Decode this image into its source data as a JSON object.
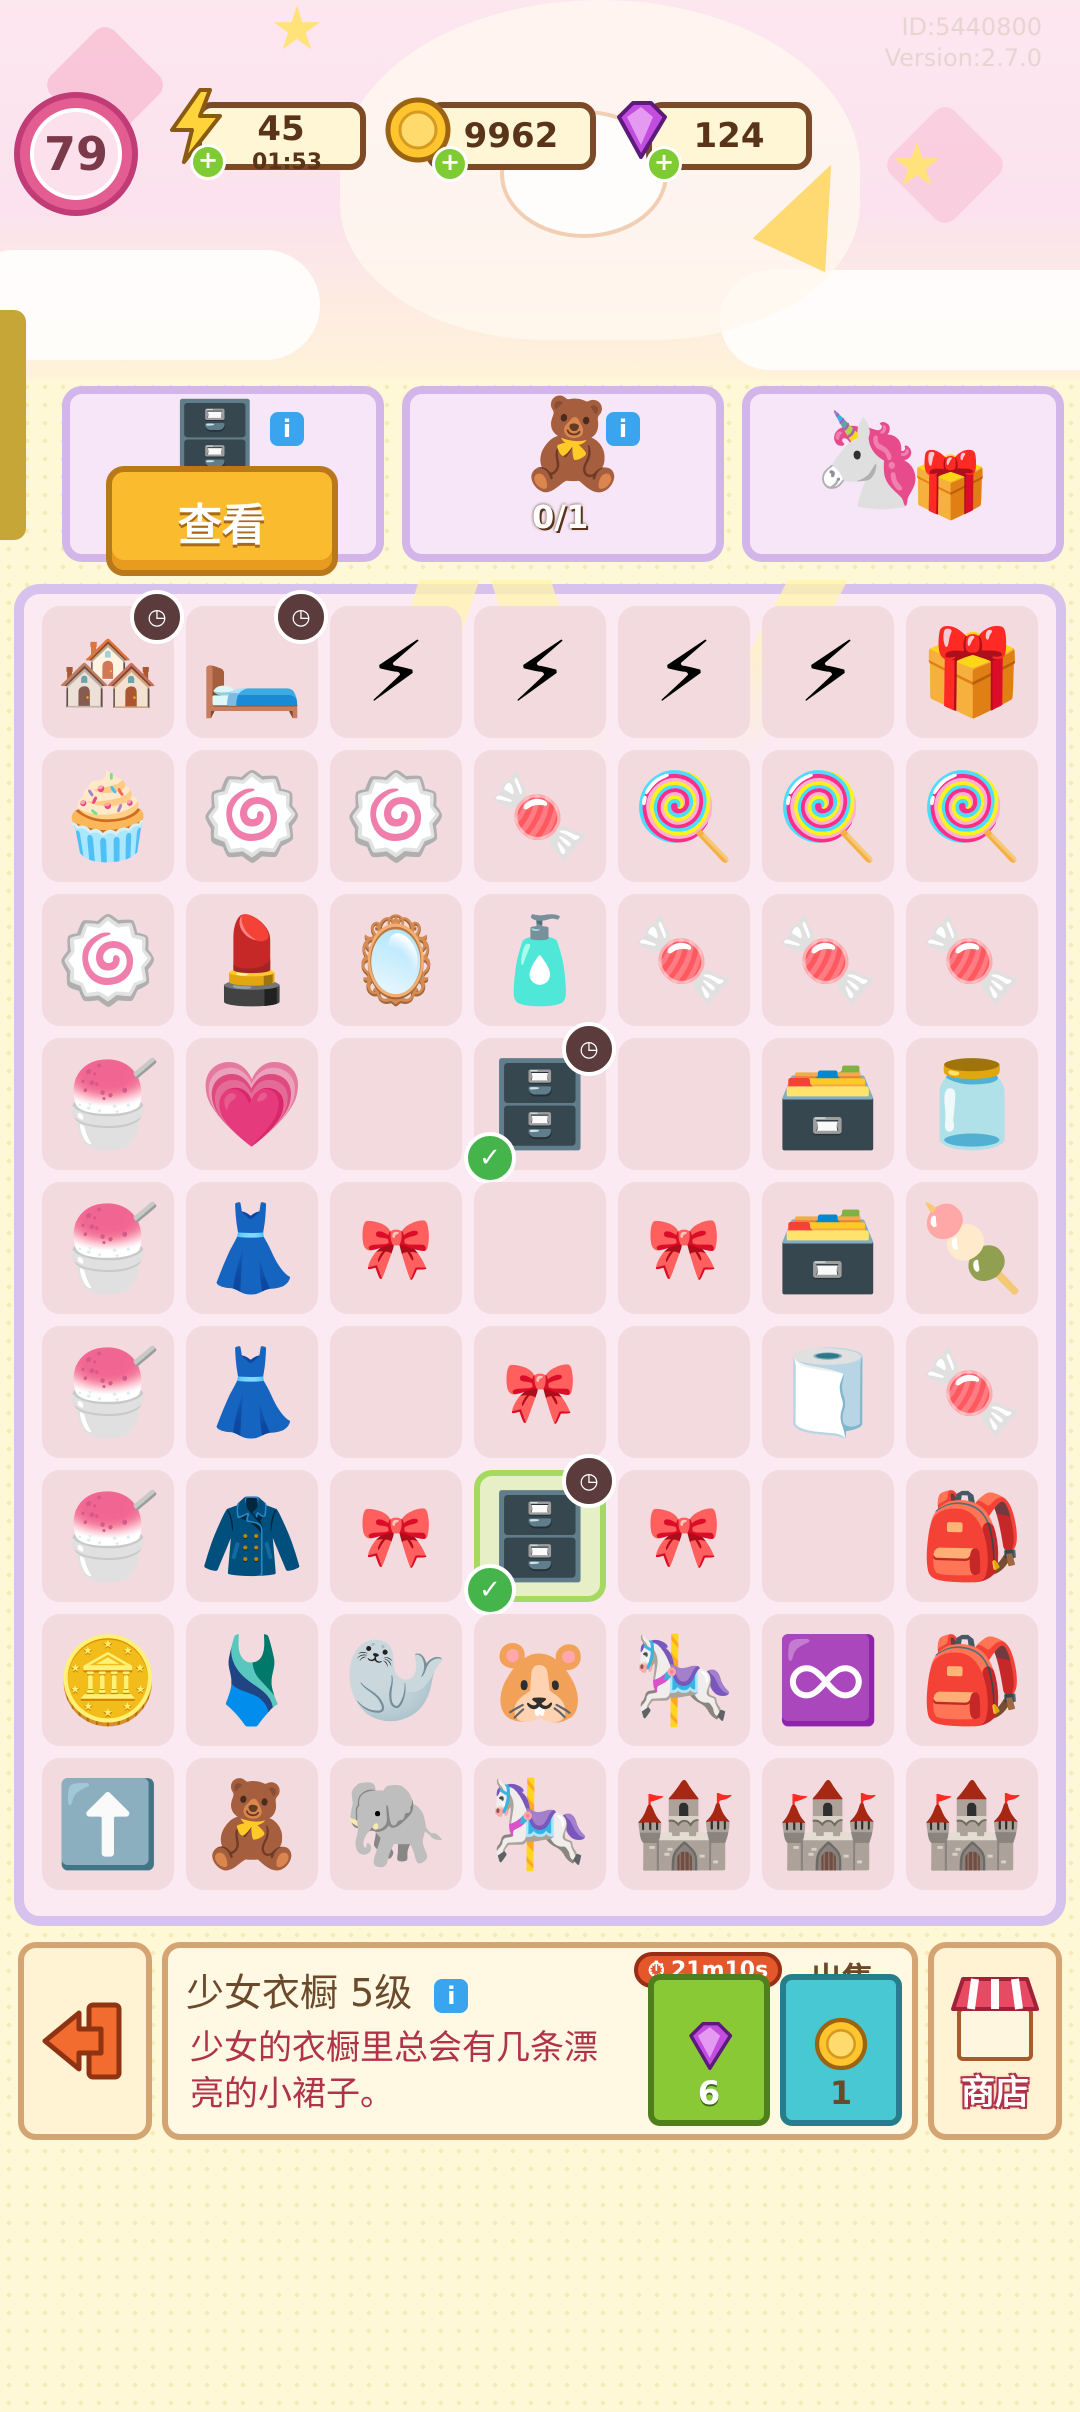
{
  "header": {
    "id_text": "ID:5440800",
    "version_text": "Version:2.7.0",
    "level": "79",
    "energy": {
      "value": "45",
      "timer": "01:53",
      "icon": "lightning-icon"
    },
    "coins": {
      "value": "9962",
      "icon": "coin-icon"
    },
    "gems": {
      "value": "124",
      "icon": "gem-icon"
    }
  },
  "tasks": {
    "view_button_label": "查看",
    "card2_progress": "0/1"
  },
  "board": {
    "cells": [
      [
        "🏘️",
        "🛏️",
        "⚡",
        "⚡",
        "⚡",
        "⚡",
        "🎁"
      ],
      [
        "🧁",
        "🍥",
        "🍥",
        "🍬",
        "🍭",
        "🍭",
        "🍭"
      ],
      [
        "🍥",
        "💄",
        "🪞",
        "🧴",
        "🍬",
        "🍬",
        "🍬"
      ],
      [
        "🍧",
        "💗",
        "",
        "🗄️",
        "",
        "🗃️",
        "🫙"
      ],
      [
        "🍧",
        "👗",
        "🎀",
        "",
        "🎀",
        "🗃️",
        "🍡"
      ],
      [
        "🍧",
        "👗",
        "",
        "🎀",
        "",
        "🧻",
        "🍬"
      ],
      [
        "🍧",
        "🧥",
        "🎀",
        "🗄️",
        "🎀",
        "",
        "🎒"
      ],
      [
        "🪙",
        "🩱",
        "🦭",
        "🐹",
        "🎠",
        "♾️",
        "🎒"
      ],
      [
        "⬆️",
        "🧸",
        "🐘",
        "🎠",
        "🏰",
        "🏰",
        "🏰"
      ]
    ]
  },
  "panel": {
    "item_name": "少女衣橱 5级",
    "item_desc": "少女的衣橱里总会有几条漂亮的小裙子。",
    "speed_timer": "21m10s",
    "speed_cost": "6",
    "sell_label": "出售",
    "sell_value": "1",
    "shop_label": "商店"
  }
}
